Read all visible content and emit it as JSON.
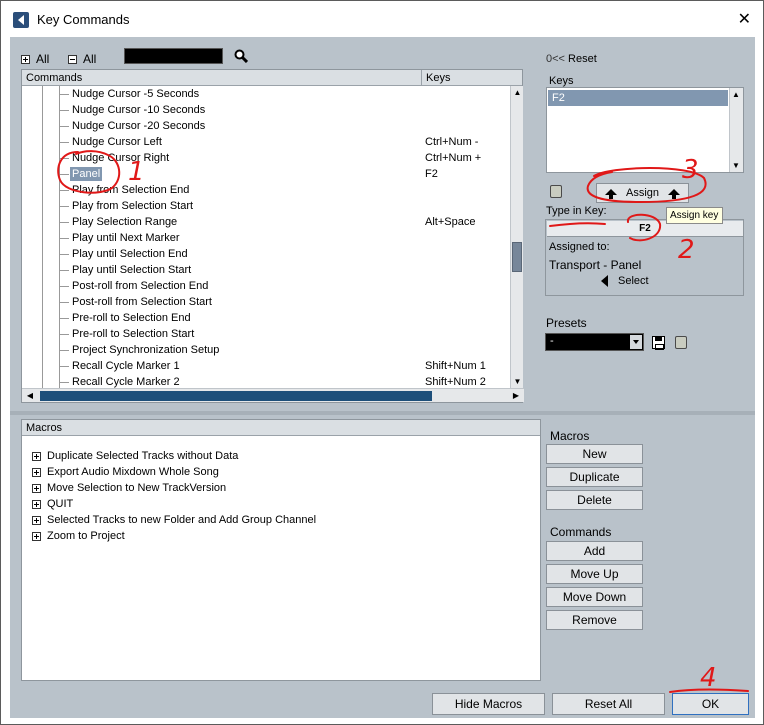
{
  "window": {
    "title": "Key Commands",
    "close": "✕"
  },
  "toolbar": {
    "expand_all": "All",
    "collapse_all": "All",
    "search_value": ""
  },
  "reset": {
    "symbol": "0<<",
    "label": "Reset"
  },
  "commands": {
    "header_commands": "Commands",
    "header_keys": "Keys",
    "rows": [
      {
        "name": "Nudge Cursor -5 Seconds",
        "key": ""
      },
      {
        "name": "Nudge Cursor -10 Seconds",
        "key": ""
      },
      {
        "name": "Nudge Cursor -20 Seconds",
        "key": ""
      },
      {
        "name": "Nudge Cursor Left",
        "key": "Ctrl+Num -"
      },
      {
        "name": "Nudge Cursor Right",
        "key": "Ctrl+Num +"
      },
      {
        "name": "Panel",
        "key": "F2"
      },
      {
        "name": "Play from Selection End",
        "key": ""
      },
      {
        "name": "Play from Selection Start",
        "key": ""
      },
      {
        "name": "Play Selection Range",
        "key": "Alt+Space"
      },
      {
        "name": "Play until Next Marker",
        "key": ""
      },
      {
        "name": "Play until Selection End",
        "key": ""
      },
      {
        "name": "Play until Selection Start",
        "key": ""
      },
      {
        "name": "Post-roll from Selection End",
        "key": ""
      },
      {
        "name": "Post-roll from Selection Start",
        "key": ""
      },
      {
        "name": "Pre-roll to Selection End",
        "key": ""
      },
      {
        "name": "Pre-roll to Selection Start",
        "key": ""
      },
      {
        "name": "Project Synchronization Setup",
        "key": ""
      },
      {
        "name": "Recall Cycle Marker 1",
        "key": "Shift+Num 1"
      },
      {
        "name": "Recall Cycle Marker 2",
        "key": "Shift+Num 2"
      }
    ]
  },
  "keys_panel": {
    "label": "Keys",
    "selected": "F2"
  },
  "assign": {
    "label": "Assign",
    "tooltip": "Assign key"
  },
  "type_in": {
    "label": "Type in Key:",
    "value": "F2",
    "assigned_to_label": "Assigned to:",
    "assigned_to_value": "Transport - Panel",
    "select_label": "Select"
  },
  "presets": {
    "label": "Presets",
    "value": "-"
  },
  "macros": {
    "header": "Macros",
    "items": [
      "Duplicate Selected Tracks without Data",
      "Export Audio Mixdown Whole Song",
      "Move Selection to New TrackVersion",
      "QUIT",
      "Selected Tracks to new Folder and Add Group Channel",
      "Zoom to Project"
    ]
  },
  "macro_side": {
    "label": "Macros",
    "new": "New",
    "duplicate": "Duplicate",
    "delete": "Delete"
  },
  "command_side": {
    "label": "Commands",
    "add": "Add",
    "move_up": "Move Up",
    "move_down": "Move Down",
    "remove": "Remove"
  },
  "bottom": {
    "hide_macros": "Hide Macros",
    "reset_all": "Reset All",
    "ok": "OK"
  },
  "annotations": [
    "1",
    "2",
    "3",
    "4"
  ],
  "colors": {
    "annotation": "#e01818",
    "selection": "#8197b0",
    "panel_bg": "#b9c2ca"
  }
}
